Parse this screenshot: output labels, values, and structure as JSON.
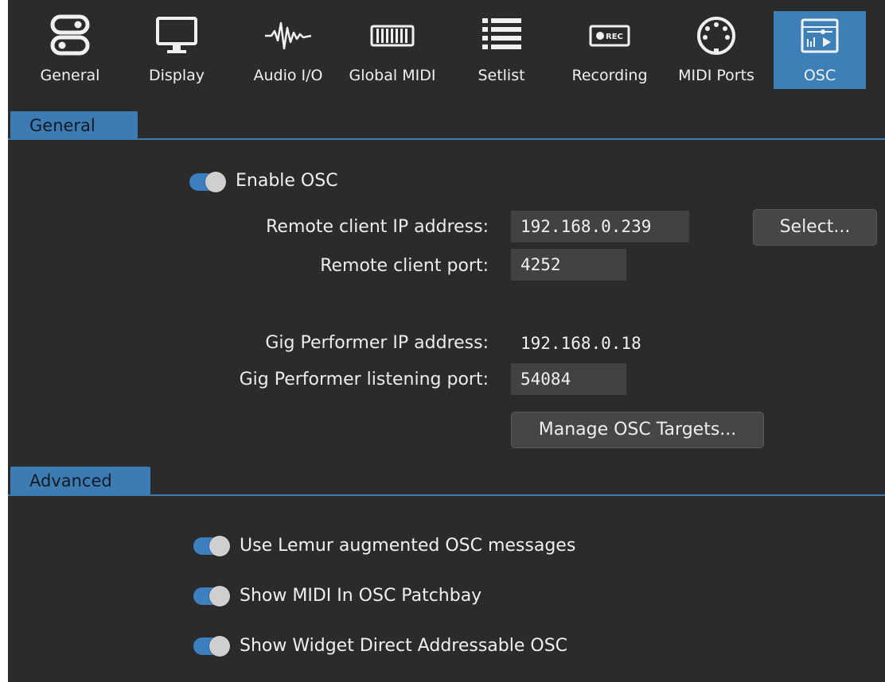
{
  "toolbar": {
    "tabs": [
      {
        "label": "General",
        "icon": "toggles-icon"
      },
      {
        "label": "Display",
        "icon": "monitor-icon"
      },
      {
        "label": "Audio I/O",
        "icon": "waveform-icon"
      },
      {
        "label": "Global MIDI",
        "icon": "keyboard-icon"
      },
      {
        "label": "Setlist",
        "icon": "list-icon"
      },
      {
        "label": "Recording",
        "icon": "rec-icon"
      },
      {
        "label": "MIDI Ports",
        "icon": "midi-port-icon"
      },
      {
        "label": "OSC",
        "icon": "osc-icon"
      }
    ],
    "active_tab": "OSC"
  },
  "general": {
    "section_title": "General",
    "enable_osc_label": "Enable OSC",
    "enable_osc_on": true,
    "remote_ip_label": "Remote client IP address:",
    "remote_ip_value": "192.168.0.239",
    "select_button": "Select...",
    "remote_port_label": "Remote client port:",
    "remote_port_value": "4252",
    "gp_ip_label": "Gig Performer IP address:",
    "gp_ip_value": "192.168.0.18",
    "gp_port_label": "Gig Performer listening port:",
    "gp_port_value": "54084",
    "manage_button": "Manage OSC Targets..."
  },
  "advanced": {
    "section_title": "Advanced",
    "options": [
      {
        "label": "Use Lemur augmented OSC messages",
        "on": true
      },
      {
        "label": "Show MIDI In OSC Patchbay",
        "on": true
      },
      {
        "label": "Show Widget Direct Addressable OSC",
        "on": true
      }
    ]
  },
  "colors": {
    "background": "#2b2b2b",
    "accent": "#3d80b8",
    "field_bg": "#424242",
    "toggle_track": "#3d80c0",
    "toggle_knob": "#cfcfcf"
  }
}
